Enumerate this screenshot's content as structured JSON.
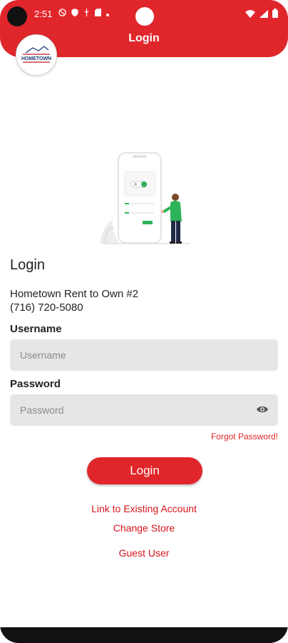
{
  "status_bar": {
    "time": "2:51",
    "left_icons": [
      "shield-block-icon",
      "shield-icon",
      "usb-icon",
      "sd-card-icon",
      "dot-icon"
    ],
    "right_icons": [
      "wifi-icon",
      "signal-icon",
      "battery-icon"
    ]
  },
  "app_bar": {
    "title": "Login",
    "logo_text": "HOMETOWN",
    "color": "#e0262b"
  },
  "illustration": {
    "icon": "phone-login-illustration"
  },
  "login_section": {
    "heading": "Login",
    "store_name": "Hometown Rent to Own #2",
    "store_phone": "(716) 720-5080"
  },
  "form": {
    "username_label": "Username",
    "username_placeholder": "Username",
    "password_label": "Password",
    "password_placeholder": "Password",
    "forgot_password": "Forgot Password!",
    "login_button": "Login"
  },
  "links": {
    "link_existing": "Link to Existing Account",
    "change_store": "Change Store",
    "guest_user": "Guest User"
  },
  "colors": {
    "accent": "#e0262b",
    "input_bg": "#e6e6e6",
    "illustration_green": "#2eb35a"
  }
}
